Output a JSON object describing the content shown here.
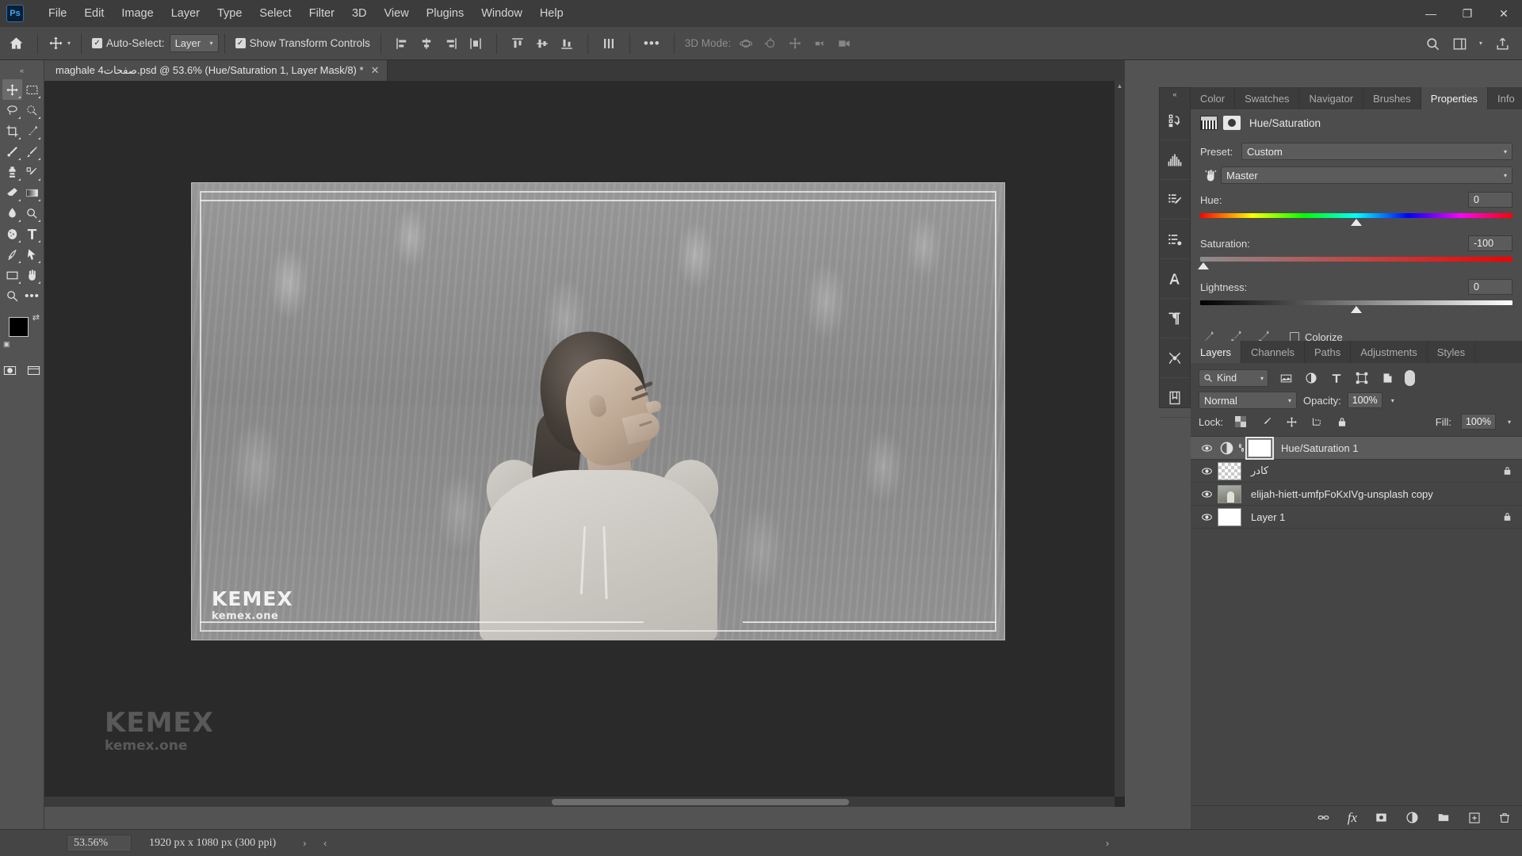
{
  "app": {
    "name": "Adobe Photoshop",
    "logo_text": "Ps"
  },
  "menubar": {
    "items": [
      {
        "label": "File"
      },
      {
        "label": "Edit"
      },
      {
        "label": "Image"
      },
      {
        "label": "Layer"
      },
      {
        "label": "Type"
      },
      {
        "label": "Select"
      },
      {
        "label": "Filter"
      },
      {
        "label": "3D"
      },
      {
        "label": "View"
      },
      {
        "label": "Plugins"
      },
      {
        "label": "Window"
      },
      {
        "label": "Help"
      }
    ]
  },
  "window_controls": {
    "minimize": "—",
    "maximize": "❐",
    "close": "✕"
  },
  "options_bar": {
    "auto_select_label": "Auto-Select:",
    "auto_select_checked": "✓",
    "layer_dropdown_value": "Layer",
    "show_transform_label": "Show Transform Controls",
    "show_transform_checked": "✓",
    "more_label": "•••",
    "mode_3d_label": "3D Mode:"
  },
  "document": {
    "tab_title": "maghale 4صفحات.psd @ 53.6% (Hue/Saturation 1, Layer Mask/8) *",
    "close_glyph": "✕"
  },
  "canvas": {
    "watermark_main": "KEMEX",
    "watermark_sub": "kemex.one",
    "artboard_watermark_main": "KEMEX",
    "artboard_watermark_sub": "kemex.one"
  },
  "status_bar": {
    "zoom": "53.56%",
    "dimensions": "1920 px x 1080 px (300 ppi)",
    "arrow_right": "›",
    "arrow_left": "‹",
    "arrow_far_right": "›"
  },
  "right_dock": {
    "collapse_glyph": "«",
    "panel_tabs": [
      {
        "label": "Color",
        "active": false
      },
      {
        "label": "Swatches",
        "active": false
      },
      {
        "label": "Navigator",
        "active": false
      },
      {
        "label": "Brushes",
        "active": false
      },
      {
        "label": "Properties",
        "active": true
      },
      {
        "label": "Info",
        "active": false
      }
    ]
  },
  "properties": {
    "title": "Hue/Saturation",
    "preset_label": "Preset:",
    "preset_value": "Custom",
    "channel_value": "Master",
    "hue": {
      "label": "Hue:",
      "value": "0",
      "thumb_pct": 50
    },
    "saturation": {
      "label": "Saturation:",
      "value": "-100",
      "thumb_pct": 1
    },
    "lightness": {
      "label": "Lightness:",
      "value": "0",
      "thumb_pct": 50
    },
    "colorize_label": "Colorize",
    "colorize_checked": false,
    "footer_icons": [
      "clip-to-layer-icon",
      "toggle-preview-icon",
      "reset-icon",
      "visibility-icon",
      "delete-icon"
    ]
  },
  "layers_panel": {
    "tabs": [
      {
        "label": "Layers",
        "active": true
      },
      {
        "label": "Channels",
        "active": false
      },
      {
        "label": "Paths",
        "active": false
      },
      {
        "label": "Adjustments",
        "active": false
      },
      {
        "label": "Styles",
        "active": false
      }
    ],
    "filter_kind": "Kind",
    "blend_mode": "Normal",
    "opacity_label": "Opacity:",
    "opacity_value": "100%",
    "lock_label": "Lock:",
    "fill_label": "Fill:",
    "fill_value": "100%",
    "layers": [
      {
        "name": "Hue/Saturation 1",
        "visible": true,
        "selected": true,
        "thumb_type": "adjustment",
        "has_mask": true,
        "linked": true,
        "locked": false
      },
      {
        "name": "کادر",
        "visible": true,
        "selected": false,
        "thumb_type": "checker",
        "has_mask": false,
        "linked": false,
        "locked": true
      },
      {
        "name": "elijah-hiett-umfpFoKxIVg-unsplash copy",
        "visible": true,
        "selected": false,
        "thumb_type": "photo",
        "has_mask": false,
        "linked": false,
        "locked": false
      },
      {
        "name": "Layer 1",
        "visible": true,
        "selected": false,
        "thumb_type": "white",
        "has_mask": false,
        "linked": false,
        "locked": true
      }
    ],
    "footer_icons": [
      "link-layers-icon",
      "layer-style-fx-icon",
      "add-mask-icon",
      "adjustment-layer-icon",
      "new-group-icon",
      "new-layer-icon",
      "delete-layer-icon"
    ],
    "fx_label": "fx"
  },
  "toolbar": {
    "tools": [
      {
        "name": "move-tool",
        "active": true
      },
      {
        "name": "marquee-tool",
        "active": false
      },
      {
        "name": "lasso-tool",
        "active": false
      },
      {
        "name": "quick-select-tool",
        "active": false
      },
      {
        "name": "crop-tool",
        "active": false
      },
      {
        "name": "eyedropper-tool",
        "active": false
      },
      {
        "name": "healing-brush-tool",
        "active": false
      },
      {
        "name": "brush-tool",
        "active": false
      },
      {
        "name": "clone-stamp-tool",
        "active": false
      },
      {
        "name": "history-brush-tool",
        "active": false
      },
      {
        "name": "eraser-tool",
        "active": false
      },
      {
        "name": "gradient-tool",
        "active": false
      },
      {
        "name": "blur-tool",
        "active": false
      },
      {
        "name": "dodge-tool",
        "active": false
      },
      {
        "name": "pen-tool",
        "active": false
      },
      {
        "name": "type-tool",
        "active": false
      },
      {
        "name": "path-selection-tool",
        "active": false
      },
      {
        "name": "shape-tool",
        "active": false
      },
      {
        "name": "hand-tool",
        "active": false
      },
      {
        "name": "zoom-tool",
        "active": false
      },
      {
        "name": "more-tools",
        "active": false
      }
    ],
    "foreground_color": "#000000",
    "background_color": "#ffffff"
  },
  "colors": {
    "chrome": "#535353",
    "panel": "#4d4d4d",
    "dark_panel": "#3f3f3f",
    "canvas": "#2a2a2a",
    "accent_text": "#e8e8e8"
  }
}
